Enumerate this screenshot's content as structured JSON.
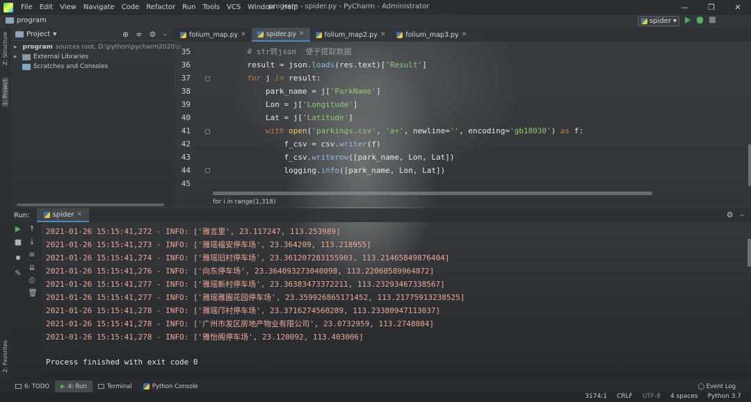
{
  "window": {
    "title": "program - spider.py - PyCharm - Administrator",
    "menu": [
      "File",
      "Edit",
      "View",
      "Navigate",
      "Code",
      "Refactor",
      "Run",
      "Tools",
      "VCS",
      "Window",
      "Help"
    ],
    "controls": [
      "—",
      "❐",
      "✕"
    ]
  },
  "navbar": {
    "project": "program",
    "run_config": "spider"
  },
  "side_tools": {
    "structure": "Z: Structure",
    "project": "1: Project",
    "favorites": "2: Favorites"
  },
  "project_panel": {
    "header": "Project",
    "tree": [
      {
        "name": "program",
        "detail": "sources root, D:\\python\\pycharm2020\\p"
      },
      {
        "name": "External Libraries",
        "detail": ""
      },
      {
        "name": "Scratches and Consoles",
        "detail": ""
      }
    ]
  },
  "tabs": [
    {
      "label": "folium_map.py",
      "active": false
    },
    {
      "label": "spider.py",
      "active": true
    },
    {
      "label": "folium_map2.py",
      "active": false
    },
    {
      "label": "folium_map3.py",
      "active": false
    }
  ],
  "editor": {
    "lines": [
      {
        "n": "35",
        "text": "    # str转json  便于提取数据"
      },
      {
        "n": "36",
        "text": "    result = json.loads(res.text)['Result']"
      },
      {
        "n": "37",
        "text": "    for j in result:"
      },
      {
        "n": "38",
        "text": "        park_name = j['ParkName']"
      },
      {
        "n": "39",
        "text": "        Lon = j['Longitude']"
      },
      {
        "n": "40",
        "text": "        Lat = j['Latitude']"
      },
      {
        "n": "41",
        "text": "        with open('parkings.csv', 'a+', newline='', encoding='gb18030') as f:"
      },
      {
        "n": "42",
        "text": "            f_csv = csv.writer(f)"
      },
      {
        "n": "43",
        "text": "            f_csv.writerow([park_name, Lon, Lat])"
      },
      {
        "n": "44",
        "text": "            logging.info([park_name, Lon, Lat])"
      },
      {
        "n": "45",
        "text": ""
      }
    ],
    "breadcrumb": "for i in range(1,318)"
  },
  "run_panel": {
    "label": "Run:",
    "tab": "spider",
    "log": [
      "2021-01-26 15:15:41,272 - INFO: ['雅言里', 23.117247, 113.253989]",
      "2021-01-26 15:15:41,273 - INFO: ['雅瑶福安停车场', 23.364209, 113.218955]",
      "2021-01-26 15:15:41,274 - INFO: ['雅瑶旧村停车场', 23.361207283155903, 113.21465849876404]",
      "2021-01-26 15:15:41,276 - INFO: ['向东停车场', 23.364093273040098, 113.22060589964872]",
      "2021-01-26 15:15:41,277 - INFO: ['雅瑶新村停车场', 23.36383473372211, 113.23293467338567]",
      "2021-01-26 15:15:41,277 - INFO: ['雅瑶雅園花园停车场', 23.359926865171452, 113.21775913238525]",
      "2021-01-26 15:15:41,278 - INFO: ['雅瑶邝村停车场', 23.3716274560289, 113.23380947113037]",
      "2021-01-26 15:15:41,278 - INFO: ['广州市发区房地产物业有限公司', 23.0732959, 113.2748084]",
      "2021-01-26 15:15:41,278 - INFO: ['雅怡阁停车场', 23.120092, 113.403006]"
    ],
    "exit_message": "Process finished with exit code 0"
  },
  "bottom_tools": [
    {
      "label": "6: TODO",
      "active": false
    },
    {
      "label": "4: Run",
      "active": true
    },
    {
      "label": "Terminal",
      "active": false
    },
    {
      "label": "Python Console",
      "active": false
    }
  ],
  "event_log": "Event Log",
  "status": {
    "position": "3174:1",
    "line_sep": "CRLF",
    "encoding": "UTF-8",
    "indent": "4 spaces",
    "interpreter": "Python 3.7"
  }
}
